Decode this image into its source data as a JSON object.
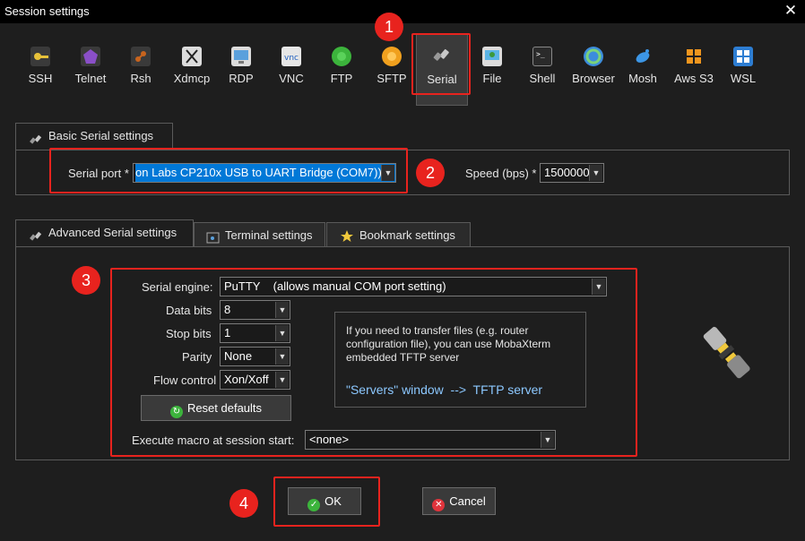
{
  "window": {
    "title": "Session settings",
    "close_glyph": "✕"
  },
  "toolbar": {
    "items": [
      {
        "label": "SSH",
        "icon": "key-icon",
        "color": "#e8c23a"
      },
      {
        "label": "Telnet",
        "icon": "telnet-icon",
        "color": "#8a4fc8"
      },
      {
        "label": "Rsh",
        "icon": "rsh-icon",
        "color": "#c8641e"
      },
      {
        "label": "Xdmcp",
        "icon": "xdmcp-icon",
        "color": "#dcdcdc"
      },
      {
        "label": "RDP",
        "icon": "rdp-icon",
        "color": "#5aa0dc"
      },
      {
        "label": "VNC",
        "icon": "vnc-icon",
        "color": "#e6e6e6"
      },
      {
        "label": "FTP",
        "icon": "ftp-icon",
        "color": "#3cb43c"
      },
      {
        "label": "SFTP",
        "icon": "sftp-icon",
        "color": "#f0a01e"
      },
      {
        "label": "Serial",
        "icon": "serial-plug-icon",
        "color": "#c8c8c8"
      },
      {
        "label": "File",
        "icon": "file-icon",
        "color": "#5ab4e6"
      },
      {
        "label": "Shell",
        "icon": "shell-icon",
        "color": "#444444"
      },
      {
        "label": "Browser",
        "icon": "globe-icon",
        "color": "#3c8cdc"
      },
      {
        "label": "Mosh",
        "icon": "satellite-icon",
        "color": "#3c96e6"
      },
      {
        "label": "Aws S3",
        "icon": "aws-s3-icon",
        "color": "#f0961e"
      },
      {
        "label": "WSL",
        "icon": "windows-icon",
        "color": "#2d7dd2"
      }
    ]
  },
  "basic": {
    "tab_label": "Basic Serial settings",
    "serial_port_label": "Serial port *",
    "serial_port_value": "on Labs CP210x USB to UART Bridge (COM7))",
    "speed_label": "Speed (bps) *",
    "speed_value": "1500000"
  },
  "advanced": {
    "tabs": [
      {
        "label": "Advanced Serial settings"
      },
      {
        "label": "Terminal settings"
      },
      {
        "label": "Bookmark settings"
      }
    ],
    "serial_engine_label": "Serial engine:",
    "serial_engine_value": "PuTTY    (allows manual COM port setting)",
    "data_bits_label": "Data bits",
    "data_bits_value": "8",
    "stop_bits_label": "Stop bits",
    "stop_bits_value": "1",
    "parity_label": "Parity",
    "parity_value": "None",
    "flow_control_label": "Flow control",
    "flow_control_value": "Xon/Xoff",
    "reset_label": "Reset defaults",
    "macro_label": "Execute macro at session start:",
    "macro_value": "<none>",
    "info_line1": "If you need to transfer files (e.g. router",
    "info_line2": "configuration file), you can use MobaXterm",
    "info_line3": "embedded TFTP server",
    "info_link": "\"Servers\" window  -->  TFTP server"
  },
  "buttons": {
    "ok_label": "OK",
    "cancel_label": "Cancel"
  },
  "annotations": {
    "badge1": "1",
    "badge2": "2",
    "badge3": "3",
    "badge4": "4"
  },
  "colors": {
    "annotation_red": "#e8231e",
    "selection_blue": "#0078d7",
    "link_blue": "#8cc8ff"
  }
}
